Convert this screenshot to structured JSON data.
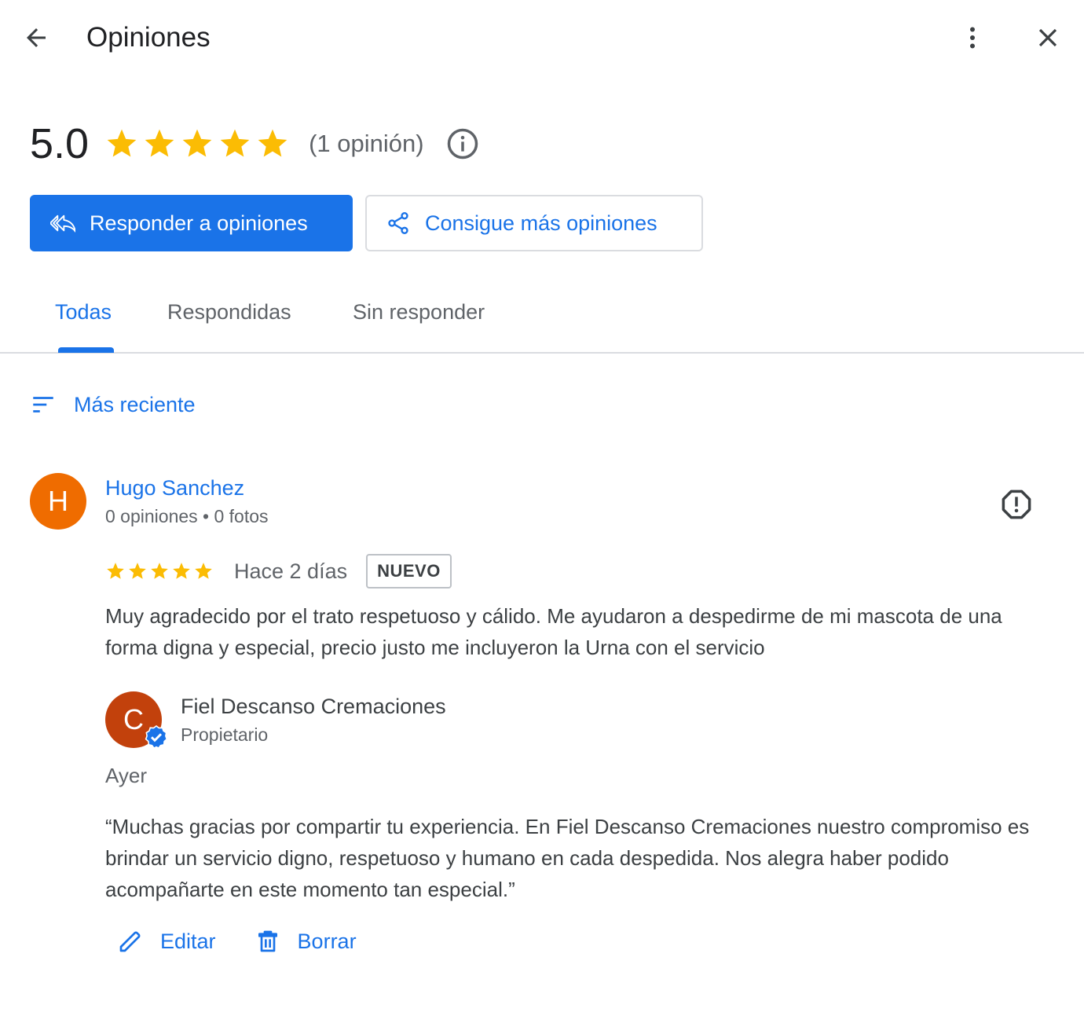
{
  "header": {
    "title": "Opiniones",
    "back_icon": "arrow-back-icon",
    "more_icon": "more-vert-icon",
    "close_icon": "close-icon"
  },
  "summary": {
    "rating": "5.0",
    "stars": 5,
    "count_text": "(1 opinión)",
    "star_color": "#fbbc04"
  },
  "buttons": {
    "reply_label": "Responder a opiniones",
    "get_more_label": "Consigue más opiniones"
  },
  "tabs": [
    {
      "label": "Todas",
      "active": true
    },
    {
      "label": "Respondidas",
      "active": false
    },
    {
      "label": "Sin responder",
      "active": false
    }
  ],
  "sort": {
    "label": "Más reciente"
  },
  "review": {
    "avatar_letter": "H",
    "avatar_color": "#ef6c00",
    "author": "Hugo Sanchez",
    "meta": "0 opiniones • 0 fotos",
    "stars": 5,
    "time": "Hace 2 días",
    "badge": "NUEVO",
    "text": "Muy agradecido por el trato respetuoso y cálido. Me ayudaron a despedirme de mi mascota de una forma digna y especial, precio justo me incluyeron la Urna con el servicio"
  },
  "reply": {
    "avatar_letter": "C",
    "avatar_color": "#c2410c",
    "owner": "Fiel Descanso Cremaciones",
    "role": "Propietario",
    "time": "Ayer",
    "text": "“Muchas gracias por compartir tu experiencia. En Fiel Descanso Cremaciones nuestro compromiso es brindar un servicio digno, respetuoso y humano en cada despedida. Nos alegra haber podido acompañarte en este momento tan especial.”",
    "edit_label": "Editar",
    "delete_label": "Borrar"
  },
  "colors": {
    "accent": "#1a73e8",
    "text": "#3c4043",
    "secondary_text": "#5f6368"
  }
}
